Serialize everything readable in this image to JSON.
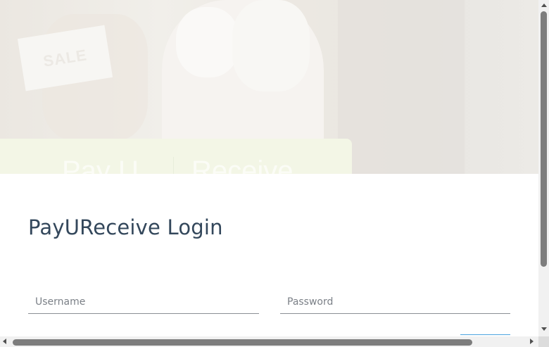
{
  "hero": {
    "sign_text": "SALE",
    "brand_left": "Pay U",
    "brand_right": "Receive"
  },
  "login": {
    "title": "PayUReceive Login",
    "username_placeholder": "Username",
    "password_placeholder": "Password"
  },
  "colors": {
    "title_text": "#33475b",
    "field_underline": "#8a8f95",
    "accent": "#4aa3df"
  },
  "icons": {
    "scroll_up": "arrow-up-icon",
    "scroll_down": "arrow-down-icon",
    "scroll_left": "arrow-left-icon",
    "scroll_right": "arrow-right-icon"
  }
}
